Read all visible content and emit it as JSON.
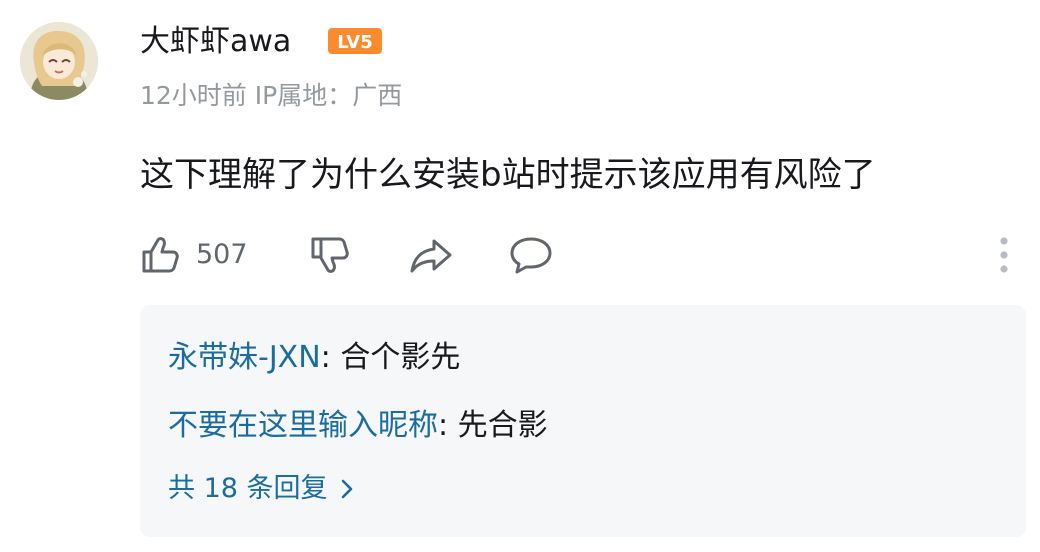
{
  "comment": {
    "user": {
      "name": "大虾虾awa",
      "level": "LV5",
      "avatar": "anime-girl-avatar"
    },
    "meta": "12小时前 IP属地：广西",
    "text": "这下理解了为什么安装b站时提示该应用有风险了",
    "actions": {
      "like_count": "507",
      "icons": [
        "thumbs-up-icon",
        "thumbs-down-icon",
        "share-icon",
        "reply-icon",
        "more-icon"
      ]
    }
  },
  "replies": {
    "items": [
      {
        "author": "永带妹-JXN",
        "separator": ": ",
        "content": "合个影先"
      },
      {
        "author": "不要在这里输入昵称",
        "separator": ": ",
        "content": "先合影"
      }
    ],
    "more_label": "共 18 条回复"
  },
  "colors": {
    "level_badge": "#fb8b2d",
    "reply_author": "#1a6ca1",
    "secondary_text": "#9499a0",
    "reply_background": "#f6f7f8"
  }
}
